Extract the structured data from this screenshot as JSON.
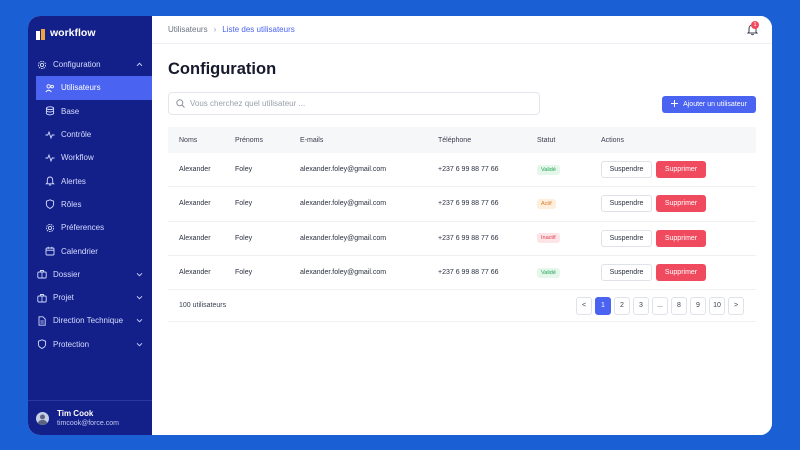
{
  "app": {
    "brand": "workflow"
  },
  "sidebar": {
    "items": [
      {
        "label": "Configuration",
        "icon": "gear-icon",
        "expandable": true,
        "expanded": true
      },
      {
        "label": "Utilisateurs",
        "icon": "users-icon",
        "active": true
      },
      {
        "label": "Base",
        "icon": "database-icon"
      },
      {
        "label": "Contrôle",
        "icon": "activity-icon"
      },
      {
        "label": "Workflow",
        "icon": "activity-icon"
      },
      {
        "label": "Alertes",
        "icon": "bell-icon"
      },
      {
        "label": "Rôles",
        "icon": "shield-icon"
      },
      {
        "label": "Préferences",
        "icon": "gear-icon"
      },
      {
        "label": "Calendrier",
        "icon": "calendar-icon"
      },
      {
        "label": "Dossier",
        "icon": "briefcase-icon",
        "expandable": true
      },
      {
        "label": "Projet",
        "icon": "briefcase-icon",
        "expandable": true
      },
      {
        "label": "Direction Technique",
        "icon": "file-icon",
        "expandable": true
      },
      {
        "label": "Protection",
        "icon": "shield-icon",
        "expandable": true
      }
    ],
    "user": {
      "name": "Tim Cook",
      "email": "timcook@force.com"
    }
  },
  "topbar": {
    "breadcrumb": [
      "Utilisateurs",
      "Liste des utilisateurs"
    ],
    "notification_count": "1"
  },
  "page": {
    "title": "Configuration",
    "search_placeholder": "Vous cherchez quel utilisateur ...",
    "add_button": "Ajouter un utilisateur"
  },
  "table": {
    "headers": {
      "nom": "Noms",
      "prenom": "Prénoms",
      "email": "E-mails",
      "tel": "Téléphone",
      "statut": "Statut",
      "actions": "Actions"
    },
    "rows": [
      {
        "nom": "Alexander",
        "prenom": "Foley",
        "email": "alexander.foley@gmail.com",
        "tel": "+237 6 99 88 77 66",
        "statut": "Validé",
        "kind": "valid",
        "suspend": "Suspendre",
        "delete": "Supprimer"
      },
      {
        "nom": "Alexander",
        "prenom": "Foley",
        "email": "alexander.foley@gmail.com",
        "tel": "+237 6 99 88 77 66",
        "statut": "Actif",
        "kind": "actif",
        "suspend": "Suspendre",
        "delete": "Supprimer"
      },
      {
        "nom": "Alexander",
        "prenom": "Foley",
        "email": "alexander.foley@gmail.com",
        "tel": "+237 6 99 88 77 66",
        "statut": "Inactif",
        "kind": "inactif",
        "suspend": "Suspendre",
        "delete": "Supprimer"
      },
      {
        "nom": "Alexander",
        "prenom": "Foley",
        "email": "alexander.foley@gmail.com",
        "tel": "+237 6 99 88 77 66",
        "statut": "Validé",
        "kind": "valid",
        "suspend": "Suspendre",
        "delete": "Supprimer"
      }
    ],
    "count_label": "100 utilisateurs"
  },
  "pagination": {
    "prev": "<",
    "pages": [
      "1",
      "2",
      "3",
      "...",
      "8",
      "9",
      "10"
    ],
    "next": ">",
    "current": "1"
  },
  "colors": {
    "sidebar": "#13208a",
    "accent": "#4a63f0",
    "danger": "#f04a5e",
    "background": "#1a5fd4"
  }
}
